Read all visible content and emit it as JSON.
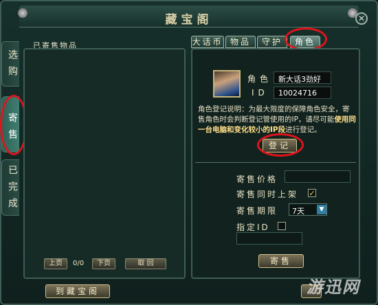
{
  "window": {
    "title": "藏宝阁",
    "close": "✕"
  },
  "side_tabs": [
    {
      "label": "选购"
    },
    {
      "label": "寄售"
    },
    {
      "label": "已完成"
    }
  ],
  "left_panel": {
    "label": "已寄售物品",
    "prev": "上页",
    "page": "0/0",
    "next": "下页",
    "cancel": "取 回"
  },
  "top_tabs": [
    {
      "label": "大话币"
    },
    {
      "label": "物品"
    },
    {
      "label": "守护"
    },
    {
      "label": "角色"
    }
  ],
  "character": {
    "name_label": "角色",
    "name_value": "新大话3劲好玩",
    "id_label": "ID",
    "id_value": "10024716"
  },
  "description": {
    "text": "角色登记说明：为最大限度的保障角色安全，寄售角色时会判断登记管使用的IP，请尽可能",
    "highlight": "使用同一台电脑和变化较小的IP段",
    "tail": "进行登记。"
  },
  "register_button": "登记",
  "form": {
    "price_label": "寄售价格",
    "auto_list_label": "寄售同时上架",
    "auto_list_checked": "✓",
    "period_label": "寄售期限",
    "period_value": "7天",
    "specify_id_label": "指定ID",
    "consign_button": "寄售"
  },
  "footer": {
    "goto_button": "到藏宝阁"
  },
  "watermark": "游迅网"
}
